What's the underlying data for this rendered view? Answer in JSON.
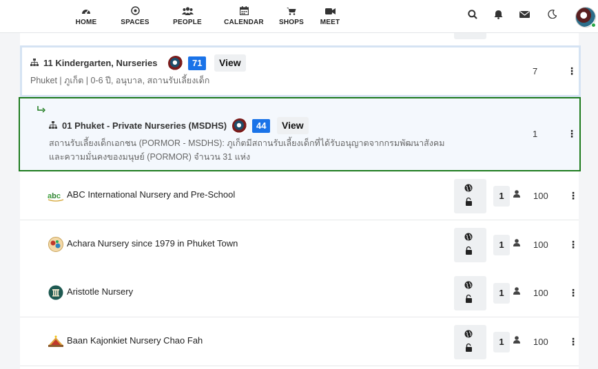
{
  "nav": {
    "items": [
      {
        "label": "HOME",
        "icon": "dashboard-icon"
      },
      {
        "label": "SPACES",
        "icon": "target-icon"
      },
      {
        "label": "PEOPLE",
        "icon": "users-icon"
      },
      {
        "label": "CALENDAR",
        "icon": "calendar-icon"
      },
      {
        "label": "SHOPS",
        "icon": "cart-icon"
      },
      {
        "label": "MEET",
        "icon": "video-icon"
      }
    ],
    "right_icons": [
      "search-icon",
      "bell-icon",
      "envelope-icon",
      "moon-icon",
      "avatar"
    ]
  },
  "parent": {
    "title": "11 Kindergarten, Nurseries",
    "badge": "71",
    "view_label": "View",
    "description": "Phuket | ภูเก็ต | 0-6 ปี, อนุบาล, สถานรับเลี้ยงเด็ก",
    "count": "7"
  },
  "child": {
    "title": "01 Phuket - Private Nurseries (MSDHS)",
    "badge": "44",
    "view_label": "View",
    "description_line1": "สถานรับเลี้ยงเด็กเอกชน (PORMOR - MSDHS): ภูเก็ตมีสถานรับเลี้ยงเด็กที่ได้รับอนุญาตจากกรมพัฒนาสังคม",
    "description_line2": "และความมั่นคงของมนุษย์ (PORMOR) จำนวน 31 แห่ง",
    "count": "1"
  },
  "rows": [
    {
      "name": "ABC International Nursery and Pre-School",
      "members": "1",
      "score": "100",
      "logo_text": "abc"
    },
    {
      "name": "Achara Nursery since 1979 in Phuket Town",
      "members": "1",
      "score": "100",
      "logo_text": ""
    },
    {
      "name": "Aristotle Nursery",
      "members": "1",
      "score": "100",
      "logo_text": ""
    },
    {
      "name": "Baan Kajonkiet Nursery Chao Fah",
      "members": "1",
      "score": "100",
      "logo_text": ""
    }
  ],
  "colors": {
    "accent": "#1a73e8",
    "selected_border": "#1c7a1c",
    "parent_border": "#d5e3f3"
  }
}
